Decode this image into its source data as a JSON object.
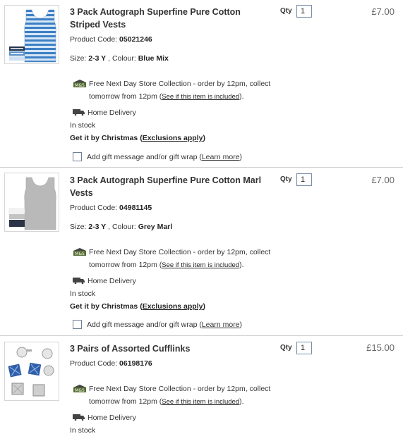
{
  "items": [
    {
      "title": "3 Pack Autograph Superfine Pure Cotton Striped Vests",
      "code_label": "Product Code:",
      "code": "05021246",
      "size_label": "Size:",
      "size": "2-3 Y",
      "colour_label": ", Colour:",
      "colour": "Blue Mix",
      "qty_label": "Qty",
      "qty": "1",
      "price": "£7.00"
    },
    {
      "title": "3 Pack Autograph Superfine Pure Cotton Marl Vests",
      "code_label": "Product Code:",
      "code": "04981145",
      "size_label": "Size:",
      "size": "2-3 Y",
      "colour_label": ", Colour:",
      "colour": "Grey Marl",
      "qty_label": "Qty",
      "qty": "1",
      "price": "£7.00"
    },
    {
      "title": "3 Pairs of Assorted Cufflinks",
      "code_label": "Product Code:",
      "code": "06198176",
      "qty_label": "Qty",
      "qty": "1",
      "price": "£15.00"
    }
  ],
  "common": {
    "collect_line1": "Free Next Day Store Collection - order by 12pm, collect",
    "collect_line2": "tomorrow from 12pm (",
    "collect_link": "See if this item is included",
    "collect_end": ").",
    "home_delivery": "Home Delivery",
    "in_stock": "In stock",
    "xmas_prefix": "Get it by Christmas (",
    "xmas_link": "Exclusions apply",
    "xmas_end": ")",
    "gift_text": "Add gift message and/or gift wrap (",
    "gift_link": "Learn more",
    "gift_end": ")"
  }
}
